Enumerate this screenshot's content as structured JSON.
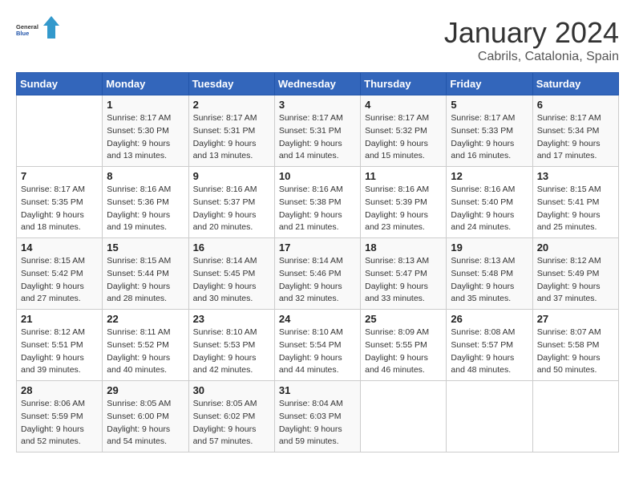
{
  "logo": {
    "general": "General",
    "blue": "Blue"
  },
  "header": {
    "month": "January 2024",
    "location": "Cabrils, Catalonia, Spain"
  },
  "weekdays": [
    "Sunday",
    "Monday",
    "Tuesday",
    "Wednesday",
    "Thursday",
    "Friday",
    "Saturday"
  ],
  "weeks": [
    [
      {
        "day": "",
        "sunrise": "",
        "sunset": "",
        "daylight": ""
      },
      {
        "day": "1",
        "sunrise": "Sunrise: 8:17 AM",
        "sunset": "Sunset: 5:30 PM",
        "daylight": "Daylight: 9 hours and 13 minutes."
      },
      {
        "day": "2",
        "sunrise": "Sunrise: 8:17 AM",
        "sunset": "Sunset: 5:31 PM",
        "daylight": "Daylight: 9 hours and 13 minutes."
      },
      {
        "day": "3",
        "sunrise": "Sunrise: 8:17 AM",
        "sunset": "Sunset: 5:31 PM",
        "daylight": "Daylight: 9 hours and 14 minutes."
      },
      {
        "day": "4",
        "sunrise": "Sunrise: 8:17 AM",
        "sunset": "Sunset: 5:32 PM",
        "daylight": "Daylight: 9 hours and 15 minutes."
      },
      {
        "day": "5",
        "sunrise": "Sunrise: 8:17 AM",
        "sunset": "Sunset: 5:33 PM",
        "daylight": "Daylight: 9 hours and 16 minutes."
      },
      {
        "day": "6",
        "sunrise": "Sunrise: 8:17 AM",
        "sunset": "Sunset: 5:34 PM",
        "daylight": "Daylight: 9 hours and 17 minutes."
      }
    ],
    [
      {
        "day": "7",
        "sunrise": "Sunrise: 8:17 AM",
        "sunset": "Sunset: 5:35 PM",
        "daylight": "Daylight: 9 hours and 18 minutes."
      },
      {
        "day": "8",
        "sunrise": "Sunrise: 8:16 AM",
        "sunset": "Sunset: 5:36 PM",
        "daylight": "Daylight: 9 hours and 19 minutes."
      },
      {
        "day": "9",
        "sunrise": "Sunrise: 8:16 AM",
        "sunset": "Sunset: 5:37 PM",
        "daylight": "Daylight: 9 hours and 20 minutes."
      },
      {
        "day": "10",
        "sunrise": "Sunrise: 8:16 AM",
        "sunset": "Sunset: 5:38 PM",
        "daylight": "Daylight: 9 hours and 21 minutes."
      },
      {
        "day": "11",
        "sunrise": "Sunrise: 8:16 AM",
        "sunset": "Sunset: 5:39 PM",
        "daylight": "Daylight: 9 hours and 23 minutes."
      },
      {
        "day": "12",
        "sunrise": "Sunrise: 8:16 AM",
        "sunset": "Sunset: 5:40 PM",
        "daylight": "Daylight: 9 hours and 24 minutes."
      },
      {
        "day": "13",
        "sunrise": "Sunrise: 8:15 AM",
        "sunset": "Sunset: 5:41 PM",
        "daylight": "Daylight: 9 hours and 25 minutes."
      }
    ],
    [
      {
        "day": "14",
        "sunrise": "Sunrise: 8:15 AM",
        "sunset": "Sunset: 5:42 PM",
        "daylight": "Daylight: 9 hours and 27 minutes."
      },
      {
        "day": "15",
        "sunrise": "Sunrise: 8:15 AM",
        "sunset": "Sunset: 5:44 PM",
        "daylight": "Daylight: 9 hours and 28 minutes."
      },
      {
        "day": "16",
        "sunrise": "Sunrise: 8:14 AM",
        "sunset": "Sunset: 5:45 PM",
        "daylight": "Daylight: 9 hours and 30 minutes."
      },
      {
        "day": "17",
        "sunrise": "Sunrise: 8:14 AM",
        "sunset": "Sunset: 5:46 PM",
        "daylight": "Daylight: 9 hours and 32 minutes."
      },
      {
        "day": "18",
        "sunrise": "Sunrise: 8:13 AM",
        "sunset": "Sunset: 5:47 PM",
        "daylight": "Daylight: 9 hours and 33 minutes."
      },
      {
        "day": "19",
        "sunrise": "Sunrise: 8:13 AM",
        "sunset": "Sunset: 5:48 PM",
        "daylight": "Daylight: 9 hours and 35 minutes."
      },
      {
        "day": "20",
        "sunrise": "Sunrise: 8:12 AM",
        "sunset": "Sunset: 5:49 PM",
        "daylight": "Daylight: 9 hours and 37 minutes."
      }
    ],
    [
      {
        "day": "21",
        "sunrise": "Sunrise: 8:12 AM",
        "sunset": "Sunset: 5:51 PM",
        "daylight": "Daylight: 9 hours and 39 minutes."
      },
      {
        "day": "22",
        "sunrise": "Sunrise: 8:11 AM",
        "sunset": "Sunset: 5:52 PM",
        "daylight": "Daylight: 9 hours and 40 minutes."
      },
      {
        "day": "23",
        "sunrise": "Sunrise: 8:10 AM",
        "sunset": "Sunset: 5:53 PM",
        "daylight": "Daylight: 9 hours and 42 minutes."
      },
      {
        "day": "24",
        "sunrise": "Sunrise: 8:10 AM",
        "sunset": "Sunset: 5:54 PM",
        "daylight": "Daylight: 9 hours and 44 minutes."
      },
      {
        "day": "25",
        "sunrise": "Sunrise: 8:09 AM",
        "sunset": "Sunset: 5:55 PM",
        "daylight": "Daylight: 9 hours and 46 minutes."
      },
      {
        "day": "26",
        "sunrise": "Sunrise: 8:08 AM",
        "sunset": "Sunset: 5:57 PM",
        "daylight": "Daylight: 9 hours and 48 minutes."
      },
      {
        "day": "27",
        "sunrise": "Sunrise: 8:07 AM",
        "sunset": "Sunset: 5:58 PM",
        "daylight": "Daylight: 9 hours and 50 minutes."
      }
    ],
    [
      {
        "day": "28",
        "sunrise": "Sunrise: 8:06 AM",
        "sunset": "Sunset: 5:59 PM",
        "daylight": "Daylight: 9 hours and 52 minutes."
      },
      {
        "day": "29",
        "sunrise": "Sunrise: 8:05 AM",
        "sunset": "Sunset: 6:00 PM",
        "daylight": "Daylight: 9 hours and 54 minutes."
      },
      {
        "day": "30",
        "sunrise": "Sunrise: 8:05 AM",
        "sunset": "Sunset: 6:02 PM",
        "daylight": "Daylight: 9 hours and 57 minutes."
      },
      {
        "day": "31",
        "sunrise": "Sunrise: 8:04 AM",
        "sunset": "Sunset: 6:03 PM",
        "daylight": "Daylight: 9 hours and 59 minutes."
      },
      {
        "day": "",
        "sunrise": "",
        "sunset": "",
        "daylight": ""
      },
      {
        "day": "",
        "sunrise": "",
        "sunset": "",
        "daylight": ""
      },
      {
        "day": "",
        "sunrise": "",
        "sunset": "",
        "daylight": ""
      }
    ]
  ]
}
